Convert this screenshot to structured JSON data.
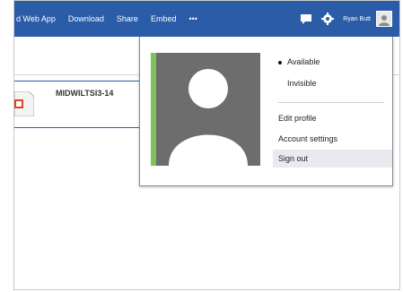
{
  "topnav": {
    "items": [
      "d Web App",
      "Download",
      "Share",
      "Embed",
      "•••"
    ],
    "username": "Ryan Butt"
  },
  "file": {
    "name": "MIDWILTSI3-14"
  },
  "account_menu": {
    "status_available": "Available",
    "status_invisible": "Invisible",
    "edit_profile": "Edit profile",
    "account_settings": "Account settings",
    "sign_out": "Sign out"
  },
  "colors": {
    "topbar": "#2a5ca8",
    "photo_bg": "#6d6d6d",
    "accent": "#7fc15a"
  }
}
